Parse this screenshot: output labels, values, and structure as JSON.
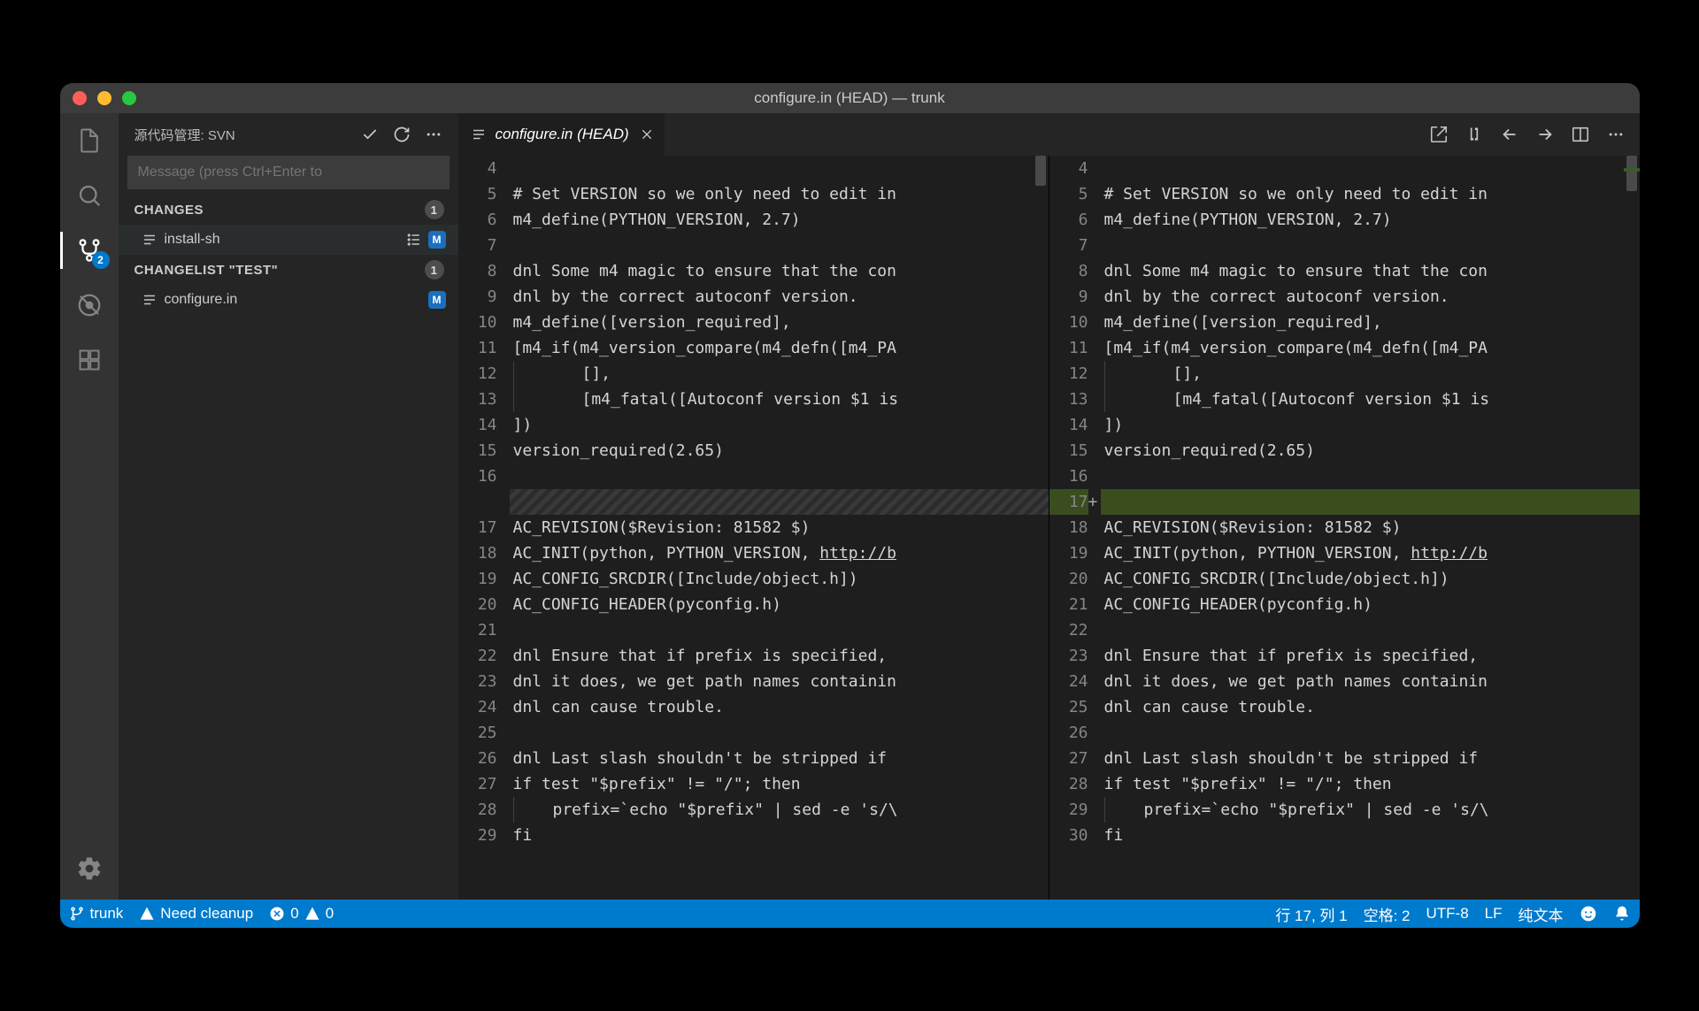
{
  "window": {
    "title": "configure.in (HEAD) — trunk"
  },
  "activity": {
    "scm_badge": "2"
  },
  "sidebar": {
    "title": "源代码管理: SVN",
    "message_placeholder": "Message (press Ctrl+Enter to",
    "changes_label": "CHANGES",
    "changes_count": "1",
    "changelist_label": "CHANGELIST \"TEST\"",
    "changelist_count": "1",
    "files": {
      "install_sh": {
        "name": "install-sh",
        "status": "M"
      },
      "configure_in": {
        "name": "configure.in",
        "status": "M"
      }
    }
  },
  "tab": {
    "label": "configure.in (HEAD)"
  },
  "left_pane": {
    "line_numbers": [
      "4",
      "5",
      "6",
      "7",
      "8",
      "9",
      "10",
      "11",
      "12",
      "13",
      "14",
      "15",
      "16",
      "",
      "17",
      "18",
      "19",
      "20",
      "21",
      "22",
      "23",
      "24",
      "25",
      "26",
      "27",
      "28",
      "29"
    ],
    "lines": [
      "",
      "# Set VERSION so we only need to edit in",
      "m4_define(PYTHON_VERSION, 2.7)",
      "",
      "dnl Some m4 magic to ensure that the con",
      "dnl by the correct autoconf version.",
      "m4_define([version_required],",
      "[m4_if(m4_version_compare(m4_defn([m4_PA",
      "       [],",
      "       [m4_fatal([Autoconf version $1 is",
      "])",
      "version_required(2.65)",
      "",
      "",
      "AC_REVISION($Revision: 81582 $)",
      "AC_INIT(python, PYTHON_VERSION, http://b",
      "AC_CONFIG_SRCDIR([Include/object.h])",
      "AC_CONFIG_HEADER(pyconfig.h)",
      "",
      "dnl Ensure that if prefix is specified, ",
      "dnl it does, we get path names containin",
      "dnl can cause trouble.",
      "",
      "dnl Last slash shouldn't be stripped if ",
      "if test \"$prefix\" != \"/\"; then",
      "    prefix=`echo \"$prefix\" | sed -e 's/\\",
      "fi"
    ]
  },
  "right_pane": {
    "line_numbers": [
      "4",
      "5",
      "6",
      "7",
      "8",
      "9",
      "10",
      "11",
      "12",
      "13",
      "14",
      "15",
      "16",
      "17",
      "18",
      "19",
      "20",
      "21",
      "22",
      "23",
      "24",
      "25",
      "26",
      "27",
      "28",
      "29",
      "30"
    ],
    "lines": [
      "",
      "# Set VERSION so we only need to edit in",
      "m4_define(PYTHON_VERSION, 2.7)",
      "",
      "dnl Some m4 magic to ensure that the con",
      "dnl by the correct autoconf version.",
      "m4_define([version_required],",
      "[m4_if(m4_version_compare(m4_defn([m4_PA",
      "       [],",
      "       [m4_fatal([Autoconf version $1 is",
      "])",
      "version_required(2.65)",
      "",
      "",
      "AC_REVISION($Revision: 81582 $)",
      "AC_INIT(python, PYTHON_VERSION, http://b",
      "AC_CONFIG_SRCDIR([Include/object.h])",
      "AC_CONFIG_HEADER(pyconfig.h)",
      "",
      "dnl Ensure that if prefix is specified, ",
      "dnl it does, we get path names containin",
      "dnl can cause trouble.",
      "",
      "dnl Last slash shouldn't be stripped if ",
      "if test \"$prefix\" != \"/\"; then",
      "    prefix=`echo \"$prefix\" | sed -e 's/\\",
      "fi"
    ]
  },
  "statusbar": {
    "branch": "trunk",
    "cleanup": "Need cleanup",
    "errors": "0",
    "warnings": "0",
    "cursor": "行 17, 列 1",
    "spaces": "空格: 2",
    "encoding": "UTF-8",
    "eol": "LF",
    "lang": "纯文本"
  }
}
